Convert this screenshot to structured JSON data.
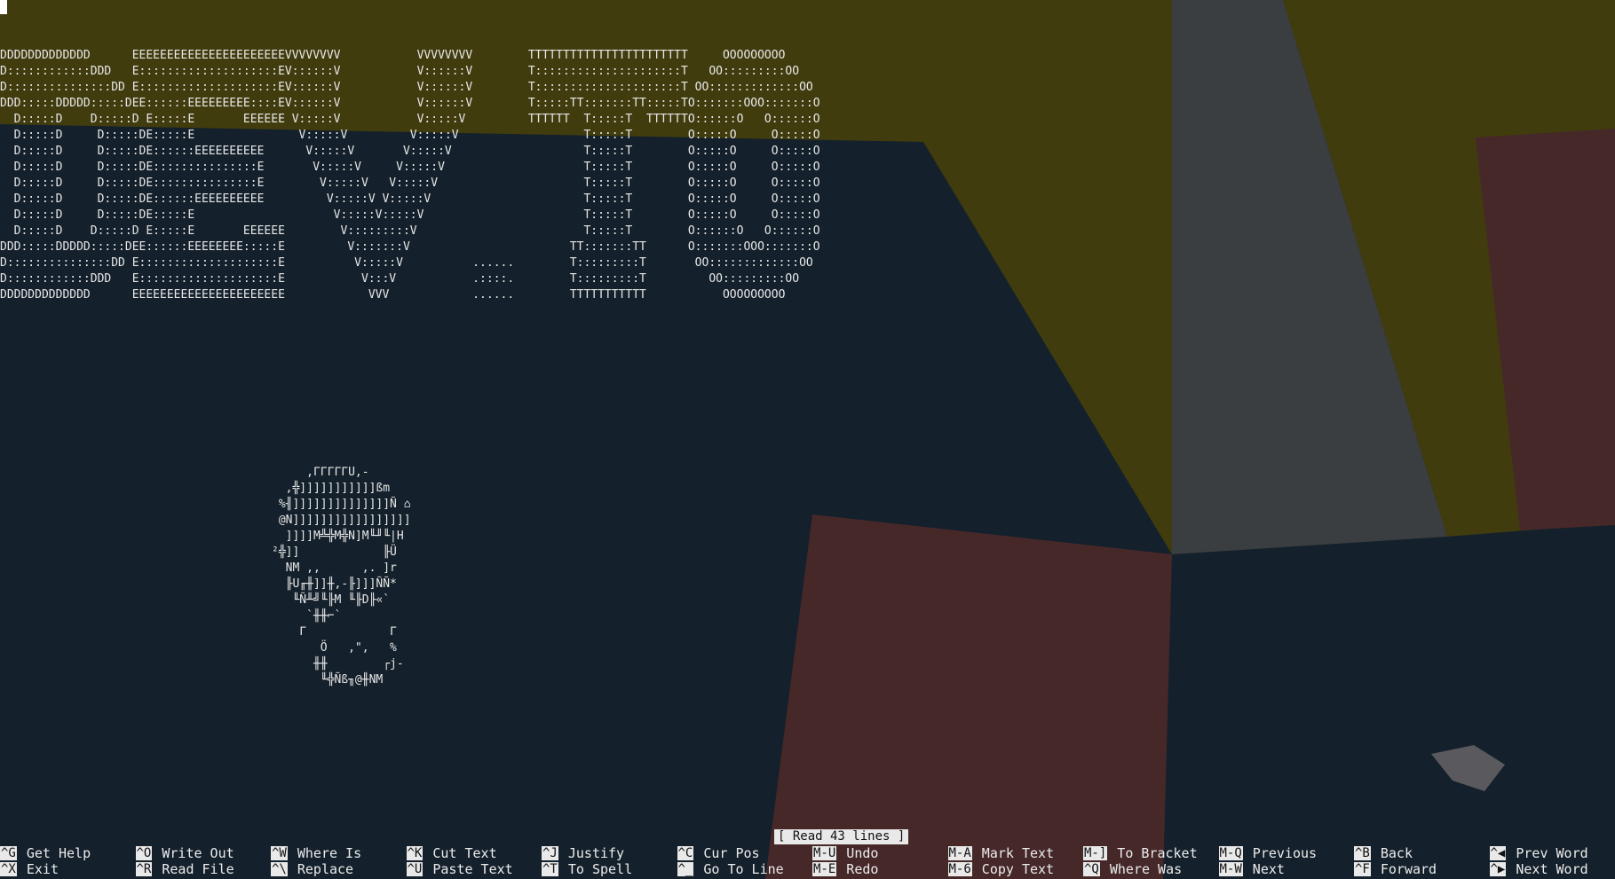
{
  "banner_lines": [
    "DDDDDDDDDDDDD      EEEEEEEEEEEEEEEEEEEEEEVVVVVVVV           VVVVVVVV        TTTTTTTTTTTTTTTTTTTTTTT     OOOOOOOOO",
    "D::::::::::::DDD   E::::::::::::::::::::EV::::::V           V::::::V        T:::::::::::::::::::::T   OO:::::::::OO",
    "D:::::::::::::::DD E::::::::::::::::::::EV::::::V           V::::::V        T:::::::::::::::::::::T OO:::::::::::::OO",
    "DDD:::::DDDDD:::::DEE::::::EEEEEEEEE::::EV::::::V           V::::::V        T:::::TT:::::::TT:::::TO:::::::OOO:::::::O",
    "  D:::::D    D:::::D E:::::E       EEEEEE V:::::V           V:::::V         TTTTTT  T:::::T  TTTTTTO::::::O   O::::::O",
    "  D:::::D     D:::::DE:::::E               V:::::V         V:::::V                  T:::::T        O:::::O     O:::::O",
    "  D:::::D     D:::::DE::::::EEEEEEEEEE      V:::::V       V:::::V                   T:::::T        O:::::O     O:::::O",
    "  D:::::D     D:::::DE:::::::::::::::E       V:::::V     V:::::V                    T:::::T        O:::::O     O:::::O",
    "  D:::::D     D:::::DE:::::::::::::::E        V:::::V   V:::::V                     T:::::T        O:::::O     O:::::O",
    "  D:::::D     D:::::DE::::::EEEEEEEEEE         V:::::V V:::::V                      T:::::T        O:::::O     O:::::O",
    "  D:::::D     D:::::DE:::::E                    V:::::V:::::V                       T:::::T        O:::::O     O:::::O",
    "  D:::::D    D:::::D E:::::E       EEEEEE        V:::::::::V                        T:::::T        O::::::O   O::::::O",
    "DDD:::::DDDDD:::::DEE::::::EEEEEEEE:::::E         V:::::::V                       TT:::::::TT      O:::::::OOO:::::::O",
    "D:::::::::::::::DD E::::::::::::::::::::E          V:::::V          ......        T:::::::::T       OO:::::::::::::OO",
    "D::::::::::::DDD   E::::::::::::::::::::E           V:::V           .::::.        T:::::::::T         OO:::::::::OO",
    "DDDDDDDDDDDDD      EEEEEEEEEEEEEEEEEEEEEE            VVV            ......        TTTTTTTTTTT           OOOOOOOOO"
  ],
  "skull_lines": [
    "     ,ΓΓΓΓΓU,-",
    "  ,╬]]]]]]]]]]]ßm",
    " %╢]]]]]]]]]]]]]]Ñ ⌂",
    " @N]]]]]]]]]]]]]]]]]",
    "  ]]]]M╩╬M╬N]M╙╜╙|H",
    "²╬]]            ╟Ü",
    "  NM ,,      ,. ]r",
    "  ╟U╓╫]]╫,-╟]]]ÑÑ*",
    "   ╙Ñ╨╝╙╟M ╙╟D╟«`",
    "     `╫╫⌐`",
    "    Γ            Γ",
    "       Ö   ,\",   %",
    "      ╫╫        ┌j-",
    "       ╙╬Ñß╖@╫NM"
  ],
  "status_message": "[ Read 43 lines ]",
  "shortcuts_row1": [
    {
      "key": "^G",
      "label": "Get Help"
    },
    {
      "key": "^O",
      "label": "Write Out"
    },
    {
      "key": "^W",
      "label": "Where Is"
    },
    {
      "key": "^K",
      "label": "Cut Text"
    },
    {
      "key": "^J",
      "label": "Justify"
    },
    {
      "key": "^C",
      "label": "Cur Pos"
    },
    {
      "key": "M-U",
      "label": "Undo"
    },
    {
      "key": "M-A",
      "label": "Mark Text"
    },
    {
      "key": "M-]",
      "label": "To Bracket"
    },
    {
      "key": "M-Q",
      "label": "Previous"
    },
    {
      "key": "^B",
      "label": "Back"
    },
    {
      "key": "^◀",
      "label": "Prev Word"
    }
  ],
  "shortcuts_row2": [
    {
      "key": "^X",
      "label": "Exit"
    },
    {
      "key": "^R",
      "label": "Read File"
    },
    {
      "key": "^\\",
      "label": "Replace"
    },
    {
      "key": "^U",
      "label": "Paste Text"
    },
    {
      "key": "^T",
      "label": "To Spell"
    },
    {
      "key": "^_",
      "label": "Go To Line"
    },
    {
      "key": "M-E",
      "label": "Redo"
    },
    {
      "key": "M-6",
      "label": "Copy Text"
    },
    {
      "key": "^Q",
      "label": "Where Was"
    },
    {
      "key": "M-W",
      "label": "Next"
    },
    {
      "key": "^F",
      "label": "Forward"
    },
    {
      "key": "^▶",
      "label": "Next Word"
    }
  ],
  "colors": {
    "background": "#14202b",
    "yellow": "#403c0e",
    "grey": "#3b3e40",
    "pink": "#462829",
    "text": "#e8e8e8",
    "highlight_bg": "#e9e9e9"
  }
}
